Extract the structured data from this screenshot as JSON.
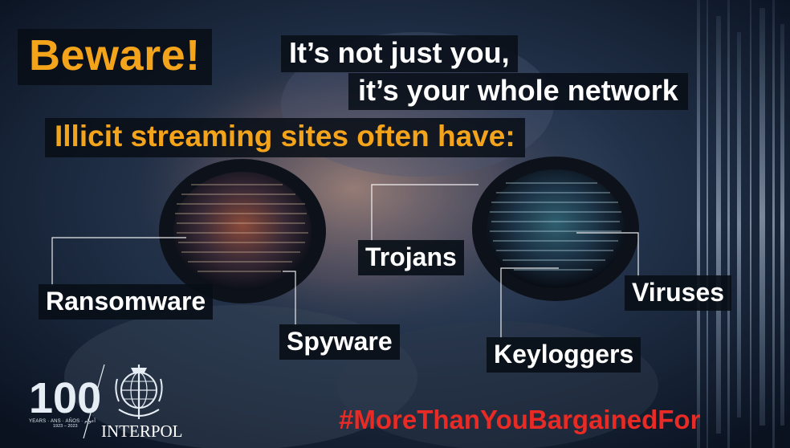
{
  "header": {
    "beware": "Beware!",
    "line1": "It’s not just you,",
    "line2": "it’s your whole network",
    "subhead": "Illicit streaming sites often have:"
  },
  "threats": [
    "Trojans",
    "Ransomware",
    "Viruses",
    "Spyware",
    "Keyloggers"
  ],
  "hashtag": "#MoreThanYouBargainedFor",
  "footer": {
    "anniversary_number": "100",
    "years_text": "YEARS · ANS · AÑOS · أعوام",
    "years_range": "1923 – 2023",
    "organization": "INTERPOL"
  },
  "colors": {
    "accent_orange": "#f4a41b",
    "hashtag_red": "#ea2a24",
    "text_white": "#ffffff",
    "background_dark": "#0b1420"
  }
}
